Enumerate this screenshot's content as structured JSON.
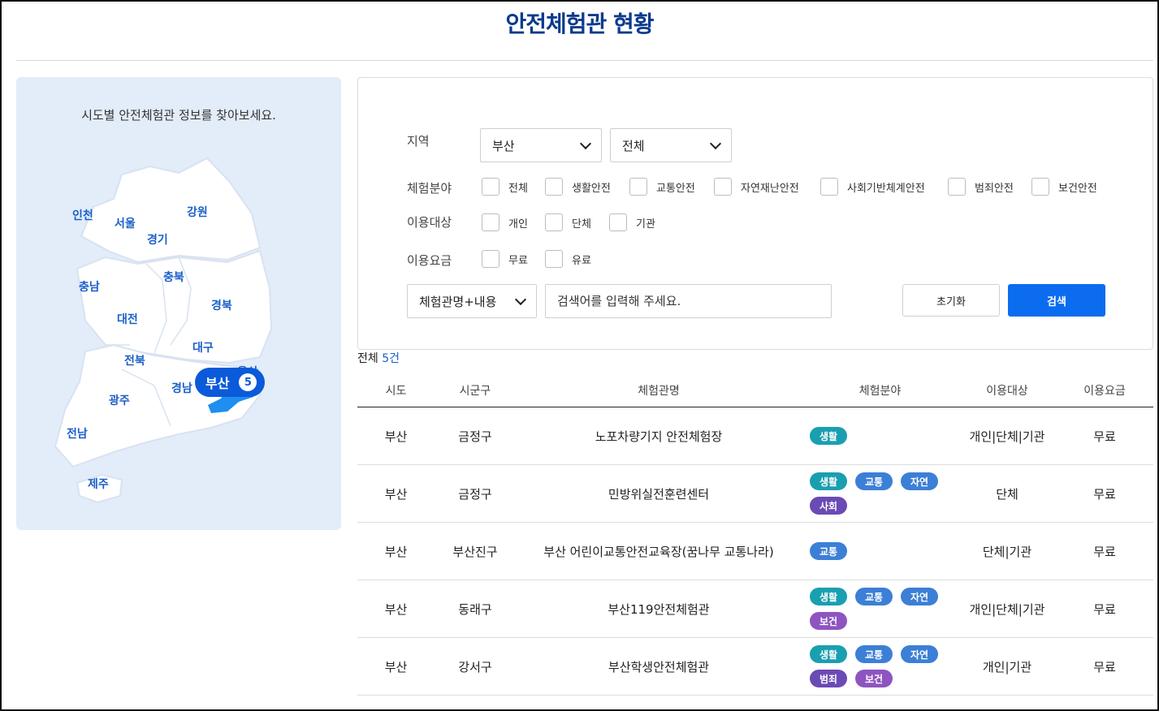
{
  "page": {
    "title": "안전체험관 현황"
  },
  "map": {
    "intro": "시도별 안전체험관 정보를 찾아보세요.",
    "regions": [
      "인천",
      "서울",
      "경기",
      "강원",
      "충남",
      "충북",
      "경북",
      "대전",
      "대구",
      "전북",
      "울산",
      "경남",
      "광주",
      "전남",
      "제주"
    ],
    "selected": {
      "label": "부산",
      "count": "5"
    }
  },
  "filters": {
    "region_label": "지역",
    "region_select": "부산",
    "district_select": "전체",
    "category_label": "체험분야",
    "categories": [
      "전체",
      "생활안전",
      "교통안전",
      "자연재난안전",
      "사회기반체계안전",
      "범죄안전",
      "보건안전"
    ],
    "target_label": "이용대상",
    "targets": [
      "개인",
      "단체",
      "기관"
    ],
    "fee_label": "이용요금",
    "fees": [
      "무료",
      "유료"
    ],
    "search_type": "체험관명+내용",
    "search_placeholder": "검색어를 입력해 주세요.",
    "reset_label": "초기화",
    "search_label": "검색"
  },
  "results": {
    "total_prefix": "전체",
    "total_count": "5건",
    "columns": [
      "시도",
      "시군구",
      "체험관명",
      "체험분야",
      "이용대상",
      "이용요금"
    ],
    "rows": [
      {
        "sido": "부산",
        "sigungu": "금정구",
        "name": "노포차량기지 안전체험장",
        "tags": [
          "생활"
        ],
        "target": "개인|단체|기관",
        "fee": "무료"
      },
      {
        "sido": "부산",
        "sigungu": "금정구",
        "name": "민방위실전훈련센터",
        "tags": [
          "생활",
          "교통",
          "자연",
          "사회"
        ],
        "target": "단체",
        "fee": "무료"
      },
      {
        "sido": "부산",
        "sigungu": "부산진구",
        "name": "부산 어린이교통안전교육장(꿈나무 교통나라)",
        "tags": [
          "교통"
        ],
        "target": "단체|기관",
        "fee": "무료"
      },
      {
        "sido": "부산",
        "sigungu": "동래구",
        "name": "부산119안전체험관",
        "tags": [
          "생활",
          "교통",
          "자연",
          "보건"
        ],
        "target": "개인|단체|기관",
        "fee": "무료"
      },
      {
        "sido": "부산",
        "sigungu": "강서구",
        "name": "부산학생안전체험관",
        "tags": [
          "생활",
          "교통",
          "자연",
          "범죄",
          "보건"
        ],
        "target": "개인|기관",
        "fee": "무료"
      }
    ]
  },
  "tag_colors": {
    "생활": "#1a9fb0",
    "교통": "#3c7fd6",
    "자연": "#3c7fd6",
    "사회": "#6a4ab5",
    "보건": "#8e54c0",
    "범죄": "#6a4ab5"
  }
}
